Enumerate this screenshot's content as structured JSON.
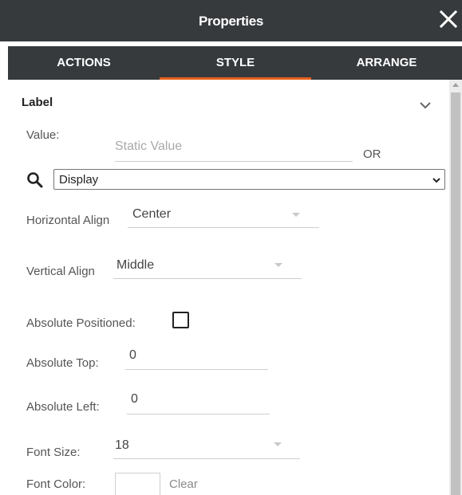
{
  "panel": {
    "title": "Properties",
    "close_icon": "close-icon"
  },
  "tabs": [
    {
      "label": "ACTIONS",
      "active": false
    },
    {
      "label": "STYLE",
      "active": true
    },
    {
      "label": "ARRANGE",
      "active": false
    }
  ],
  "accent_color": "#e8601c",
  "header_color": "#373a3d",
  "section": {
    "title": "Label",
    "chevron_icon": "chevron-down-icon"
  },
  "fields": {
    "value_label": "Value:",
    "value_placeholder": "Static Value",
    "or_label": "OR",
    "search_icon": "search-icon",
    "display_select": "Display",
    "horizontal_align_label": "Horizontal Align",
    "horizontal_align_value": "Center",
    "vertical_align_label": "Vertical Align",
    "vertical_align_value": "Middle",
    "absolute_positioned_label": "Absolute Positioned:",
    "absolute_positioned_checked": false,
    "absolute_top_label": "Absolute Top:",
    "absolute_top_value": "0",
    "absolute_left_label": "Absolute Left:",
    "absolute_left_value": "0",
    "font_size_label": "Font Size:",
    "font_size_value": "18",
    "font_color_label": "Font Color:",
    "font_color_clear": "Clear"
  }
}
